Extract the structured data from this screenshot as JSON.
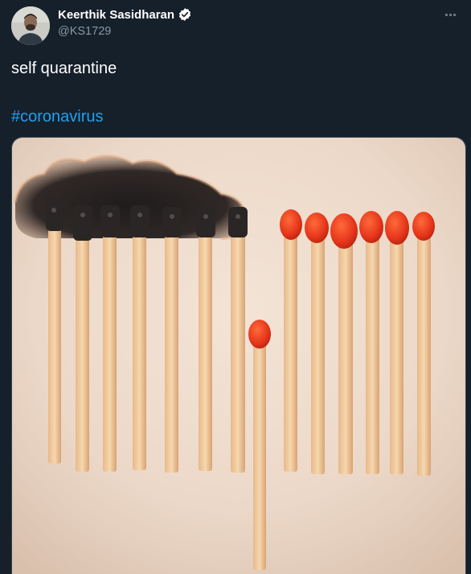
{
  "author": {
    "display_name": "Keerthik Sasidharan",
    "handle": "@KS1729",
    "verified": true,
    "avatar_icon": "profile-avatar"
  },
  "tweet": {
    "text": "self quarantine",
    "hashtag": "#coronavirus"
  },
  "media": {
    "icon": "matchsticks-photo",
    "burnt_count": 7,
    "unlit_count": 6,
    "separated_count": 1
  },
  "colors": {
    "background": "#15202b",
    "text_primary": "#ffffff",
    "text_secondary": "#8899a6",
    "link": "#1da1f2",
    "verified_badge": "#ffffff"
  }
}
